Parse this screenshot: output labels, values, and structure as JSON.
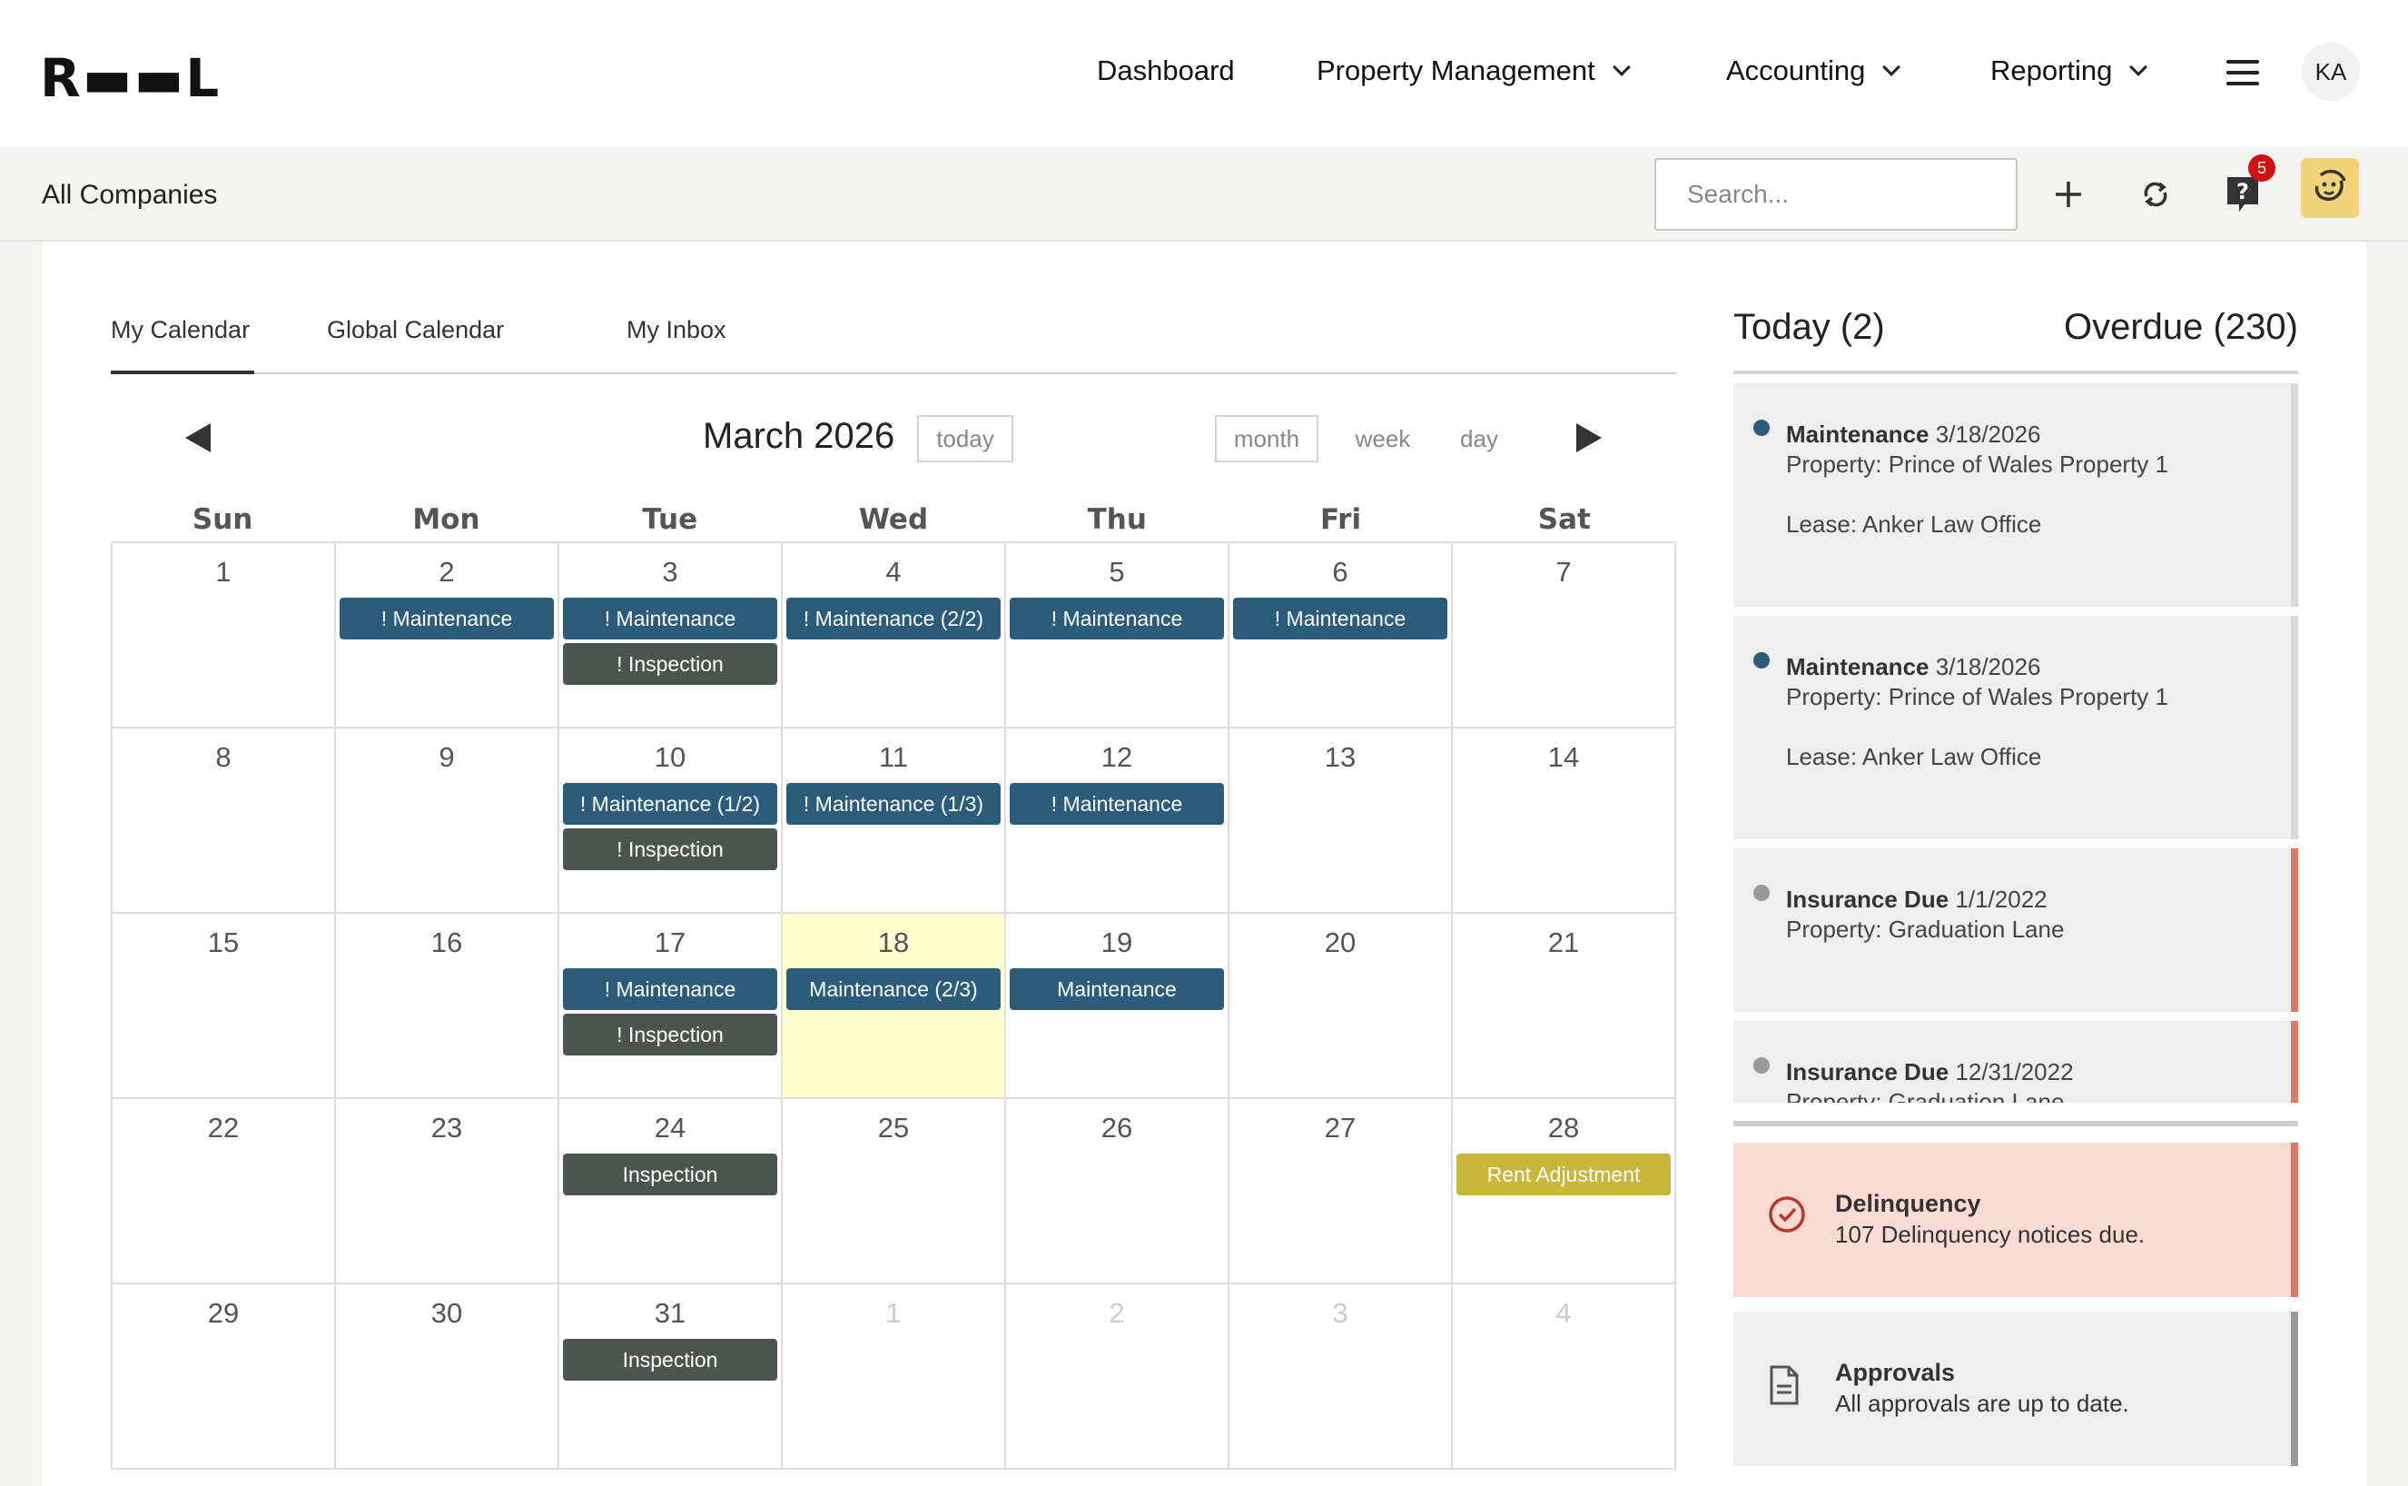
{
  "brand": {
    "logo": "R▬▬L"
  },
  "nav": {
    "items": [
      {
        "label": "Dashboard",
        "dropdown": false
      },
      {
        "label": "Property Management",
        "dropdown": true
      },
      {
        "label": "Accounting",
        "dropdown": true
      },
      {
        "label": "Reporting",
        "dropdown": true
      }
    ],
    "avatar": "KA"
  },
  "toolbar": {
    "company": "All Companies",
    "search_placeholder": "Search...",
    "notification_count": "5"
  },
  "tabs": [
    {
      "label": "My Calendar",
      "active": true
    },
    {
      "label": "Global Calendar",
      "active": false
    },
    {
      "label": "My Inbox",
      "active": false
    }
  ],
  "calendar": {
    "title": "March 2026",
    "today_btn": "today",
    "views": [
      "month",
      "week",
      "day"
    ],
    "active_view": "month",
    "days_of_week": [
      "Sun",
      "Mon",
      "Tue",
      "Wed",
      "Thu",
      "Fri",
      "Sat"
    ],
    "weeks": [
      [
        {
          "day": "1",
          "events": []
        },
        {
          "day": "2",
          "events": [
            {
              "label": "! Maintenance",
              "kind": "maint"
            }
          ]
        },
        {
          "day": "3",
          "events": [
            {
              "label": "! Maintenance",
              "kind": "maint"
            },
            {
              "label": "! Inspection",
              "kind": "insp"
            }
          ]
        },
        {
          "day": "4",
          "events": [
            {
              "label": "! Maintenance (2/2)",
              "kind": "maint"
            }
          ]
        },
        {
          "day": "5",
          "events": [
            {
              "label": "! Maintenance",
              "kind": "maint"
            }
          ]
        },
        {
          "day": "6",
          "events": [
            {
              "label": "! Maintenance",
              "kind": "maint"
            }
          ]
        },
        {
          "day": "7",
          "events": []
        }
      ],
      [
        {
          "day": "8",
          "events": []
        },
        {
          "day": "9",
          "events": []
        },
        {
          "day": "10",
          "events": [
            {
              "label": "! Maintenance (1/2)",
              "kind": "maint"
            },
            {
              "label": "! Inspection",
              "kind": "insp"
            }
          ]
        },
        {
          "day": "11",
          "events": [
            {
              "label": "! Maintenance (1/3)",
              "kind": "maint"
            }
          ]
        },
        {
          "day": "12",
          "events": [
            {
              "label": "! Maintenance",
              "kind": "maint"
            }
          ]
        },
        {
          "day": "13",
          "events": []
        },
        {
          "day": "14",
          "events": []
        }
      ],
      [
        {
          "day": "15",
          "events": []
        },
        {
          "day": "16",
          "events": []
        },
        {
          "day": "17",
          "events": [
            {
              "label": "! Maintenance",
              "kind": "maint"
            },
            {
              "label": "! Inspection",
              "kind": "insp"
            }
          ]
        },
        {
          "day": "18",
          "today": true,
          "events": [
            {
              "label": "Maintenance (2/3)",
              "kind": "maint"
            }
          ]
        },
        {
          "day": "19",
          "events": [
            {
              "label": "Maintenance",
              "kind": "maint"
            }
          ]
        },
        {
          "day": "20",
          "events": []
        },
        {
          "day": "21",
          "events": []
        }
      ],
      [
        {
          "day": "22",
          "events": []
        },
        {
          "day": "23",
          "events": []
        },
        {
          "day": "24",
          "events": [
            {
              "label": "Inspection",
              "kind": "insp"
            }
          ]
        },
        {
          "day": "25",
          "events": []
        },
        {
          "day": "26",
          "events": []
        },
        {
          "day": "27",
          "events": []
        },
        {
          "day": "28",
          "events": [
            {
              "label": "Rent Adjustment",
              "kind": "rent"
            }
          ]
        }
      ],
      [
        {
          "day": "29",
          "events": []
        },
        {
          "day": "30",
          "events": []
        },
        {
          "day": "31",
          "events": [
            {
              "label": "Inspection",
              "kind": "insp"
            }
          ]
        },
        {
          "day": "1",
          "other": true,
          "events": []
        },
        {
          "day": "2",
          "other": true,
          "events": []
        },
        {
          "day": "3",
          "other": true,
          "events": []
        },
        {
          "day": "4",
          "other": true,
          "events": []
        }
      ]
    ]
  },
  "tasks": {
    "today_label": "Today (2)",
    "overdue_label": "Overdue (230)",
    "items": [
      {
        "title": "Maintenance",
        "date": "3/18/2026",
        "line1": "Property: Prince of Wales Property 1",
        "line2": "Lease: Anker Law Office",
        "dot_color": "#2b5c7a",
        "bar_color": "#d9d9d9"
      },
      {
        "title": "Maintenance",
        "date": "3/18/2026",
        "line1": "Property: Prince of Wales Property 1",
        "line2": "Lease: Anker Law Office",
        "dot_color": "#2b5c7a",
        "bar_color": "#d9d9d9"
      },
      {
        "title": "Insurance Due",
        "date": "1/1/2022",
        "line1": "Property: Graduation Lane",
        "line2": "",
        "dot_color": "#9a9a9a",
        "bar_color": "#e07a66"
      },
      {
        "title": "Insurance Due",
        "date": "12/31/2022",
        "line1": "Property: Graduation Lane",
        "line2": "",
        "dot_color": "#9a9a9a",
        "bar_color": "#e07a66"
      }
    ]
  },
  "summary": [
    {
      "title": "Delinquency",
      "desc": "107 Delinquency notices due.",
      "icon": "check-circle-icon",
      "bg": "#fadbd4",
      "bar_color": "#e07a66"
    },
    {
      "title": "Approvals",
      "desc": "All approvals are up to date.",
      "icon": "document-icon",
      "bg": "#eeeeee",
      "bar_color": "#9a9a9a"
    }
  ]
}
